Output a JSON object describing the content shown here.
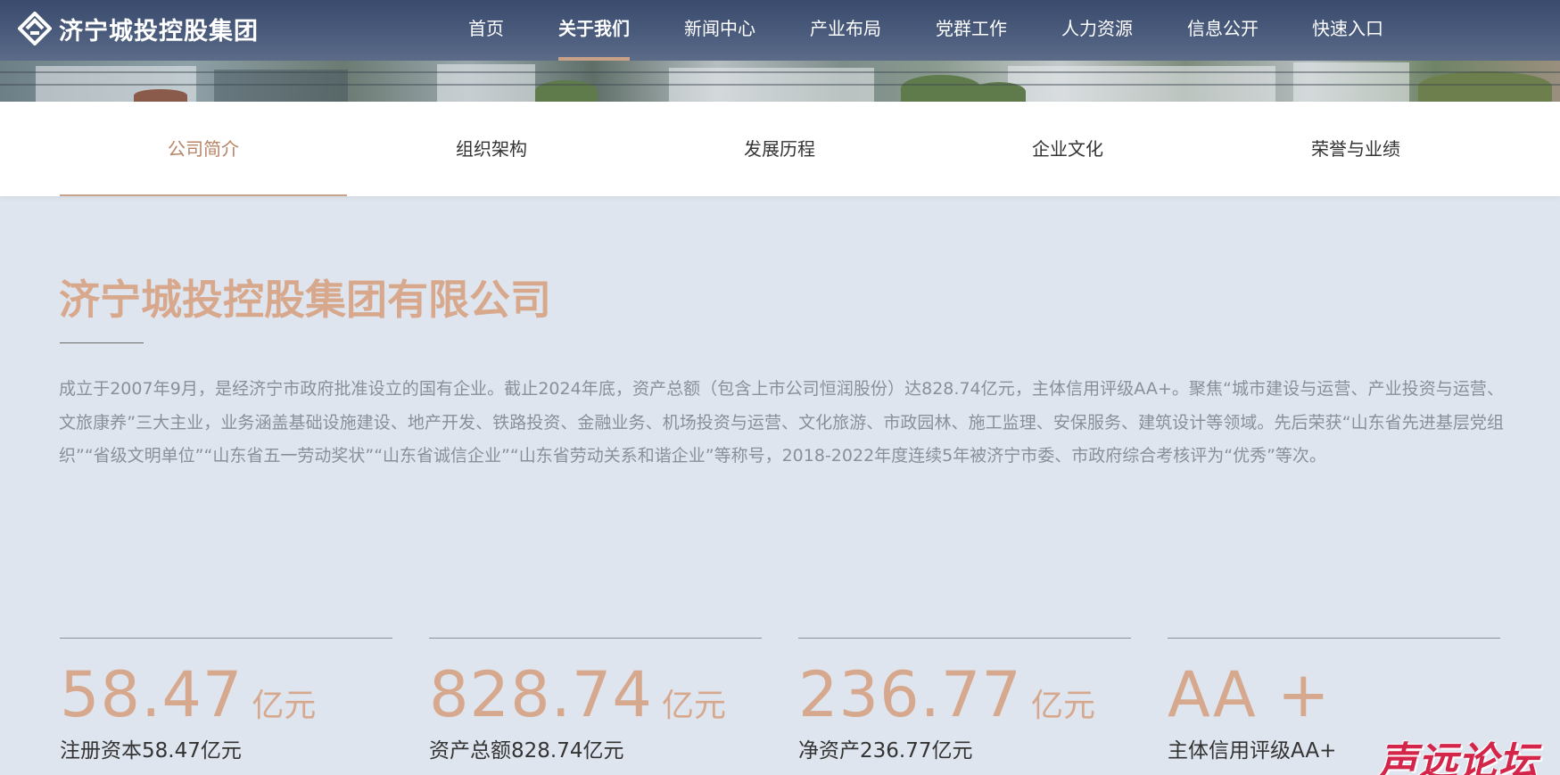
{
  "header": {
    "logo_text": "济宁城投控股集团",
    "nav": [
      {
        "label": "首页"
      },
      {
        "label": "关于我们"
      },
      {
        "label": "新闻中心"
      },
      {
        "label": "产业布局"
      },
      {
        "label": "党群工作"
      },
      {
        "label": "人力资源"
      },
      {
        "label": "信息公开"
      },
      {
        "label": "快速入口"
      }
    ],
    "active_nav": "关于我们"
  },
  "subnav": {
    "items": [
      {
        "label": "公司简介"
      },
      {
        "label": "组织架构"
      },
      {
        "label": "发展历程"
      },
      {
        "label": "企业文化"
      },
      {
        "label": "荣誉与业绩"
      }
    ],
    "active": "公司简介"
  },
  "main": {
    "title": "济宁城投控股集团有限公司",
    "intro": "成立于2007年9月，是经济宁市政府批准设立的国有企业。截止2024年底，资产总额（包含上市公司恒润股份）达828.74亿元，主体信用评级AA+。聚焦“城市建设与运营、产业投资与运营、文旅康养”三大主业，业务涵盖基础设施建设、地产开发、铁路投资、金融业务、机场投资与运营、文化旅游、市政园林、施工监理、安保服务、建筑设计等领域。先后荣获“山东省先进基层党组织”“省级文明单位”“山东省五一劳动奖状”“山东省诚信企业”“山东省劳动关系和谐企业”等称号，2018-2022年度连续5年被济宁市委、市政府综合考核评为“优秀”等次。",
    "stats": [
      {
        "value": "58.47",
        "unit": "亿元",
        "label": "注册资本58.47亿元"
      },
      {
        "value": "828.74",
        "unit": "亿元",
        "label": "资产总额828.74亿元"
      },
      {
        "value": "236.77",
        "unit": "亿元",
        "label": "净资产236.77亿元"
      },
      {
        "value": "AA +",
        "unit": "",
        "label": "主体信用评级AA+"
      }
    ]
  },
  "watermark": "声远论坛",
  "colors": {
    "header_bg": "#3f5072",
    "accent": "#d6a88e",
    "page_bg": "#dfe5ee",
    "watermark": "#d4264a"
  }
}
